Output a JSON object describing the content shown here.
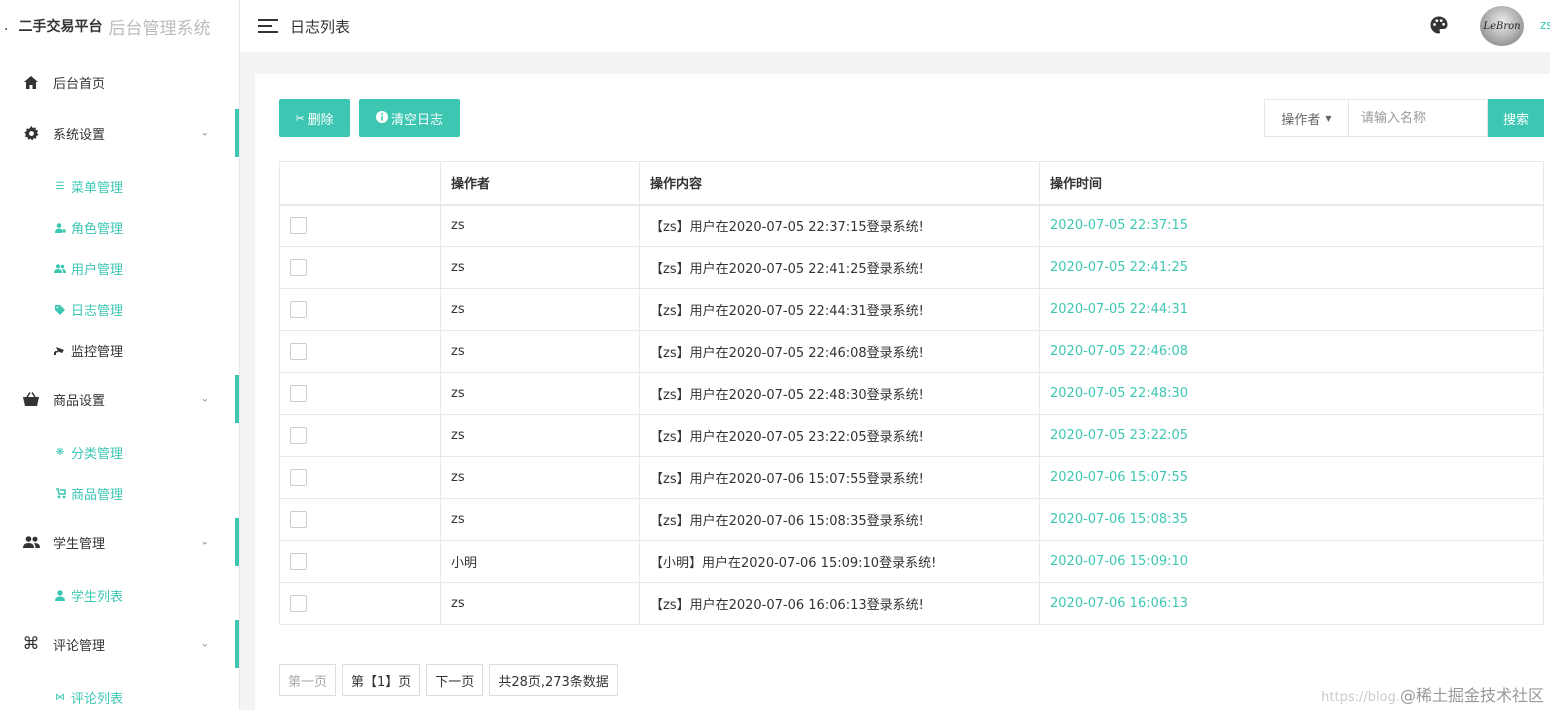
{
  "brand": {
    "dot": ".",
    "name": "二手交易平台",
    "subtitle": "后台管理系统"
  },
  "header": {
    "title": "日志列表",
    "username": "zs",
    "avatar_text": "LeBron"
  },
  "sidebar": {
    "home": {
      "label": "后台首页",
      "icon": "home-icon"
    },
    "sections": [
      {
        "label": "系统设置",
        "icon": "gear-icon",
        "items": [
          {
            "label": "菜单管理",
            "icon": "list-icon"
          },
          {
            "label": "角色管理",
            "icon": "user-cog-icon"
          },
          {
            "label": "用户管理",
            "icon": "users-icon"
          },
          {
            "label": "日志管理",
            "icon": "tags-icon"
          },
          {
            "label": "监控管理",
            "icon": "camera-icon"
          }
        ]
      },
      {
        "label": "商品设置",
        "icon": "basket-icon",
        "items": [
          {
            "label": "分类管理",
            "icon": "snowflake-icon"
          },
          {
            "label": "商品管理",
            "icon": "stroller-icon"
          }
        ]
      },
      {
        "label": "学生管理",
        "icon": "users-icon",
        "items": [
          {
            "label": "学生列表",
            "icon": "user-icon"
          }
        ]
      },
      {
        "label": "评论管理",
        "icon": "command-icon",
        "items": [
          {
            "label": "评论列表",
            "icon": "comments-icon"
          }
        ]
      }
    ]
  },
  "toolbar": {
    "delete_label": "删除",
    "clear_label": "清空日志",
    "search_select": "操作者",
    "search_placeholder": "请输入名称",
    "search_button": "搜索"
  },
  "table": {
    "columns": [
      "",
      "操作者",
      "操作内容",
      "操作时间"
    ],
    "rows": [
      {
        "operator": "zs",
        "content": "【zs】用户在2020-07-05 22:37:15登录系统!",
        "time": "2020-07-05 22:37:15"
      },
      {
        "operator": "zs",
        "content": "【zs】用户在2020-07-05 22:41:25登录系统!",
        "time": "2020-07-05 22:41:25"
      },
      {
        "operator": "zs",
        "content": "【zs】用户在2020-07-05 22:44:31登录系统!",
        "time": "2020-07-05 22:44:31"
      },
      {
        "operator": "zs",
        "content": "【zs】用户在2020-07-05 22:46:08登录系统!",
        "time": "2020-07-05 22:46:08"
      },
      {
        "operator": "zs",
        "content": "【zs】用户在2020-07-05 22:48:30登录系统!",
        "time": "2020-07-05 22:48:30"
      },
      {
        "operator": "zs",
        "content": "【zs】用户在2020-07-05 23:22:05登录系统!",
        "time": "2020-07-05 23:22:05"
      },
      {
        "operator": "zs",
        "content": "【zs】用户在2020-07-06 15:07:55登录系统!",
        "time": "2020-07-06 15:07:55"
      },
      {
        "operator": "zs",
        "content": "【zs】用户在2020-07-06 15:08:35登录系统!",
        "time": "2020-07-06 15:08:35"
      },
      {
        "operator": "小明",
        "content": "【小明】用户在2020-07-06 15:09:10登录系统!",
        "time": "2020-07-06 15:09:10"
      },
      {
        "operator": "zs",
        "content": "【zs】用户在2020-07-06 16:06:13登录系统!",
        "time": "2020-07-06 16:06:13"
      }
    ]
  },
  "pager": {
    "first": "第一页",
    "current": "第【1】页",
    "next": "下一页",
    "summary": "共28页,273条数据"
  },
  "watermark": {
    "url": "https://blog.",
    "text": "@稀土掘金技术社区"
  },
  "colors": {
    "accent": "#3dc7b3",
    "text": "#333333",
    "border": "#e7eaec"
  }
}
